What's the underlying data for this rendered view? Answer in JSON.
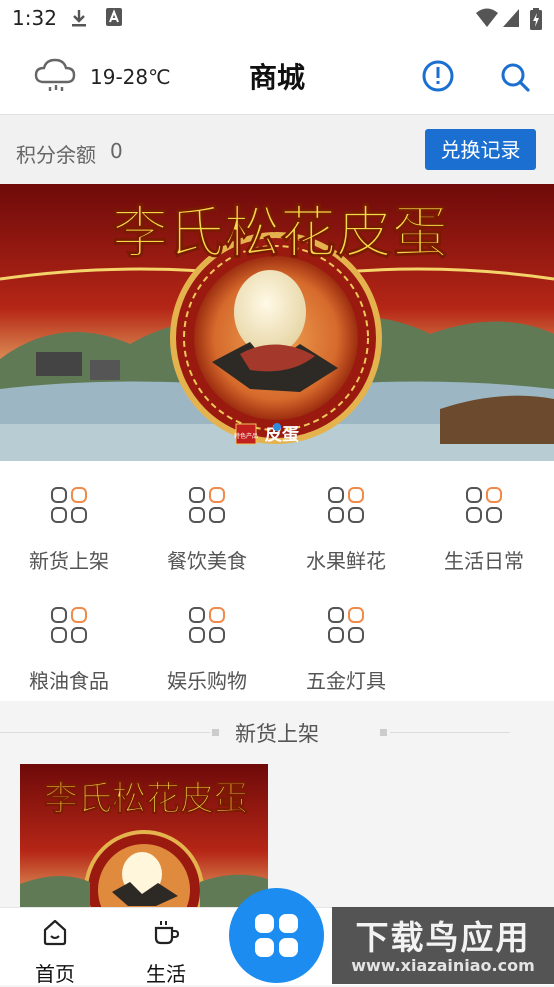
{
  "status_bar": {
    "time": "1:32"
  },
  "header": {
    "weather": {
      "temperature": "19-28℃",
      "icon": "cloud-rain-icon"
    },
    "title": "商城"
  },
  "points": {
    "label": "积分余额",
    "value": "0",
    "exchange_button": "兑换记录"
  },
  "banner": {
    "title": "李氏松花皮蛋",
    "badge": "皮蛋",
    "seal_text": "特色产品"
  },
  "categories": [
    {
      "label": "新货上架"
    },
    {
      "label": "餐饮美食"
    },
    {
      "label": "水果鲜花"
    },
    {
      "label": "生活日常"
    },
    {
      "label": "粮油食品"
    },
    {
      "label": "娱乐购物"
    },
    {
      "label": "五金灯具"
    }
  ],
  "section": {
    "title": "新货上架"
  },
  "product": {
    "title": "李氏松花皮蛋"
  },
  "tabbar": {
    "tabs": [
      {
        "label": "首页",
        "icon": "home-icon"
      },
      {
        "label": "生活",
        "icon": "cup-icon"
      }
    ]
  },
  "watermark": {
    "main": "下载鸟应用",
    "url": "www.xiazainiao.com"
  },
  "colors": {
    "accent": "#1b6fd1",
    "fab": "#1c8cf0",
    "category_icon": "#555555",
    "category_icon_highlight": "#f08a4b",
    "banner_red": "#8e0f0f"
  }
}
